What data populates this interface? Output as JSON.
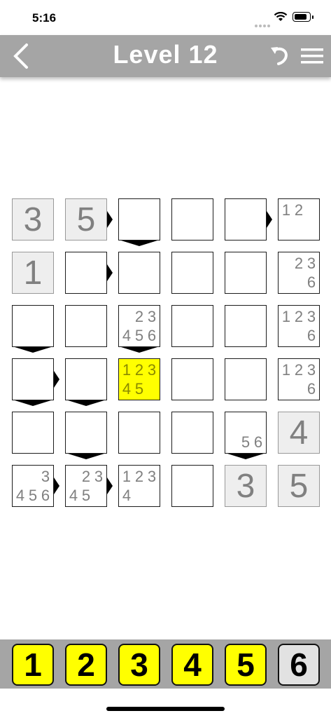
{
  "status": {
    "time": "5:16"
  },
  "header": {
    "title": "Level 12",
    "back_icon": "chevron-left-icon",
    "undo_icon": "undo-icon",
    "menu_icon": "hamburger-menu-icon"
  },
  "grid": {
    "size": 6,
    "cells": [
      [
        {
          "value": "3",
          "given": true
        },
        {
          "value": "5",
          "given": true
        },
        {},
        {},
        {},
        {
          "notes": [
            "1",
            "2",
            "",
            "",
            "",
            ""
          ]
        }
      ],
      [
        {
          "value": "1",
          "given": true
        },
        {},
        {},
        {},
        {},
        {
          "notes": [
            "",
            "2",
            "3",
            "",
            "",
            "6"
          ]
        }
      ],
      [
        {},
        {},
        {
          "notes": [
            "",
            "2",
            "3",
            "4",
            "5",
            "6"
          ]
        },
        {},
        {},
        {
          "notes": [
            "1",
            "2",
            "3",
            "",
            "",
            "6"
          ]
        }
      ],
      [
        {},
        {},
        {
          "notes": [
            "1",
            "2",
            "3",
            "4",
            "5",
            ""
          ],
          "selected": true
        },
        {},
        {},
        {
          "notes": [
            "1",
            "2",
            "3",
            "",
            "",
            "6"
          ]
        }
      ],
      [
        {},
        {},
        {},
        {},
        {
          "notes": [
            "",
            "",
            "",
            "",
            "5",
            "6"
          ]
        },
        {
          "value": "4",
          "given": true
        }
      ],
      [
        {
          "notes": [
            "",
            "",
            "3",
            "4",
            "5",
            "6"
          ]
        },
        {
          "notes": [
            "",
            "2",
            "3",
            "4",
            "5",
            ""
          ]
        },
        {
          "notes": [
            "1",
            "2",
            "3",
            "4",
            "",
            ""
          ]
        },
        {},
        {
          "value": "3",
          "given": true
        },
        {
          "value": "5",
          "given": true
        }
      ]
    ],
    "inequalities_right": [
      [
        0,
        1
      ],
      [
        0,
        4
      ],
      [
        1,
        1
      ],
      [
        3,
        0
      ],
      [
        5,
        0
      ],
      [
        5,
        1
      ]
    ],
    "inequalities_down": [
      [
        0,
        2
      ],
      [
        2,
        0
      ],
      [
        2,
        2
      ],
      [
        3,
        0
      ],
      [
        3,
        1
      ],
      [
        4,
        1
      ],
      [
        4,
        4
      ]
    ]
  },
  "keypad": [
    {
      "label": "1",
      "used": false
    },
    {
      "label": "2",
      "used": false
    },
    {
      "label": "3",
      "used": false
    },
    {
      "label": "4",
      "used": false
    },
    {
      "label": "5",
      "used": false
    },
    {
      "label": "6",
      "used": true
    }
  ]
}
